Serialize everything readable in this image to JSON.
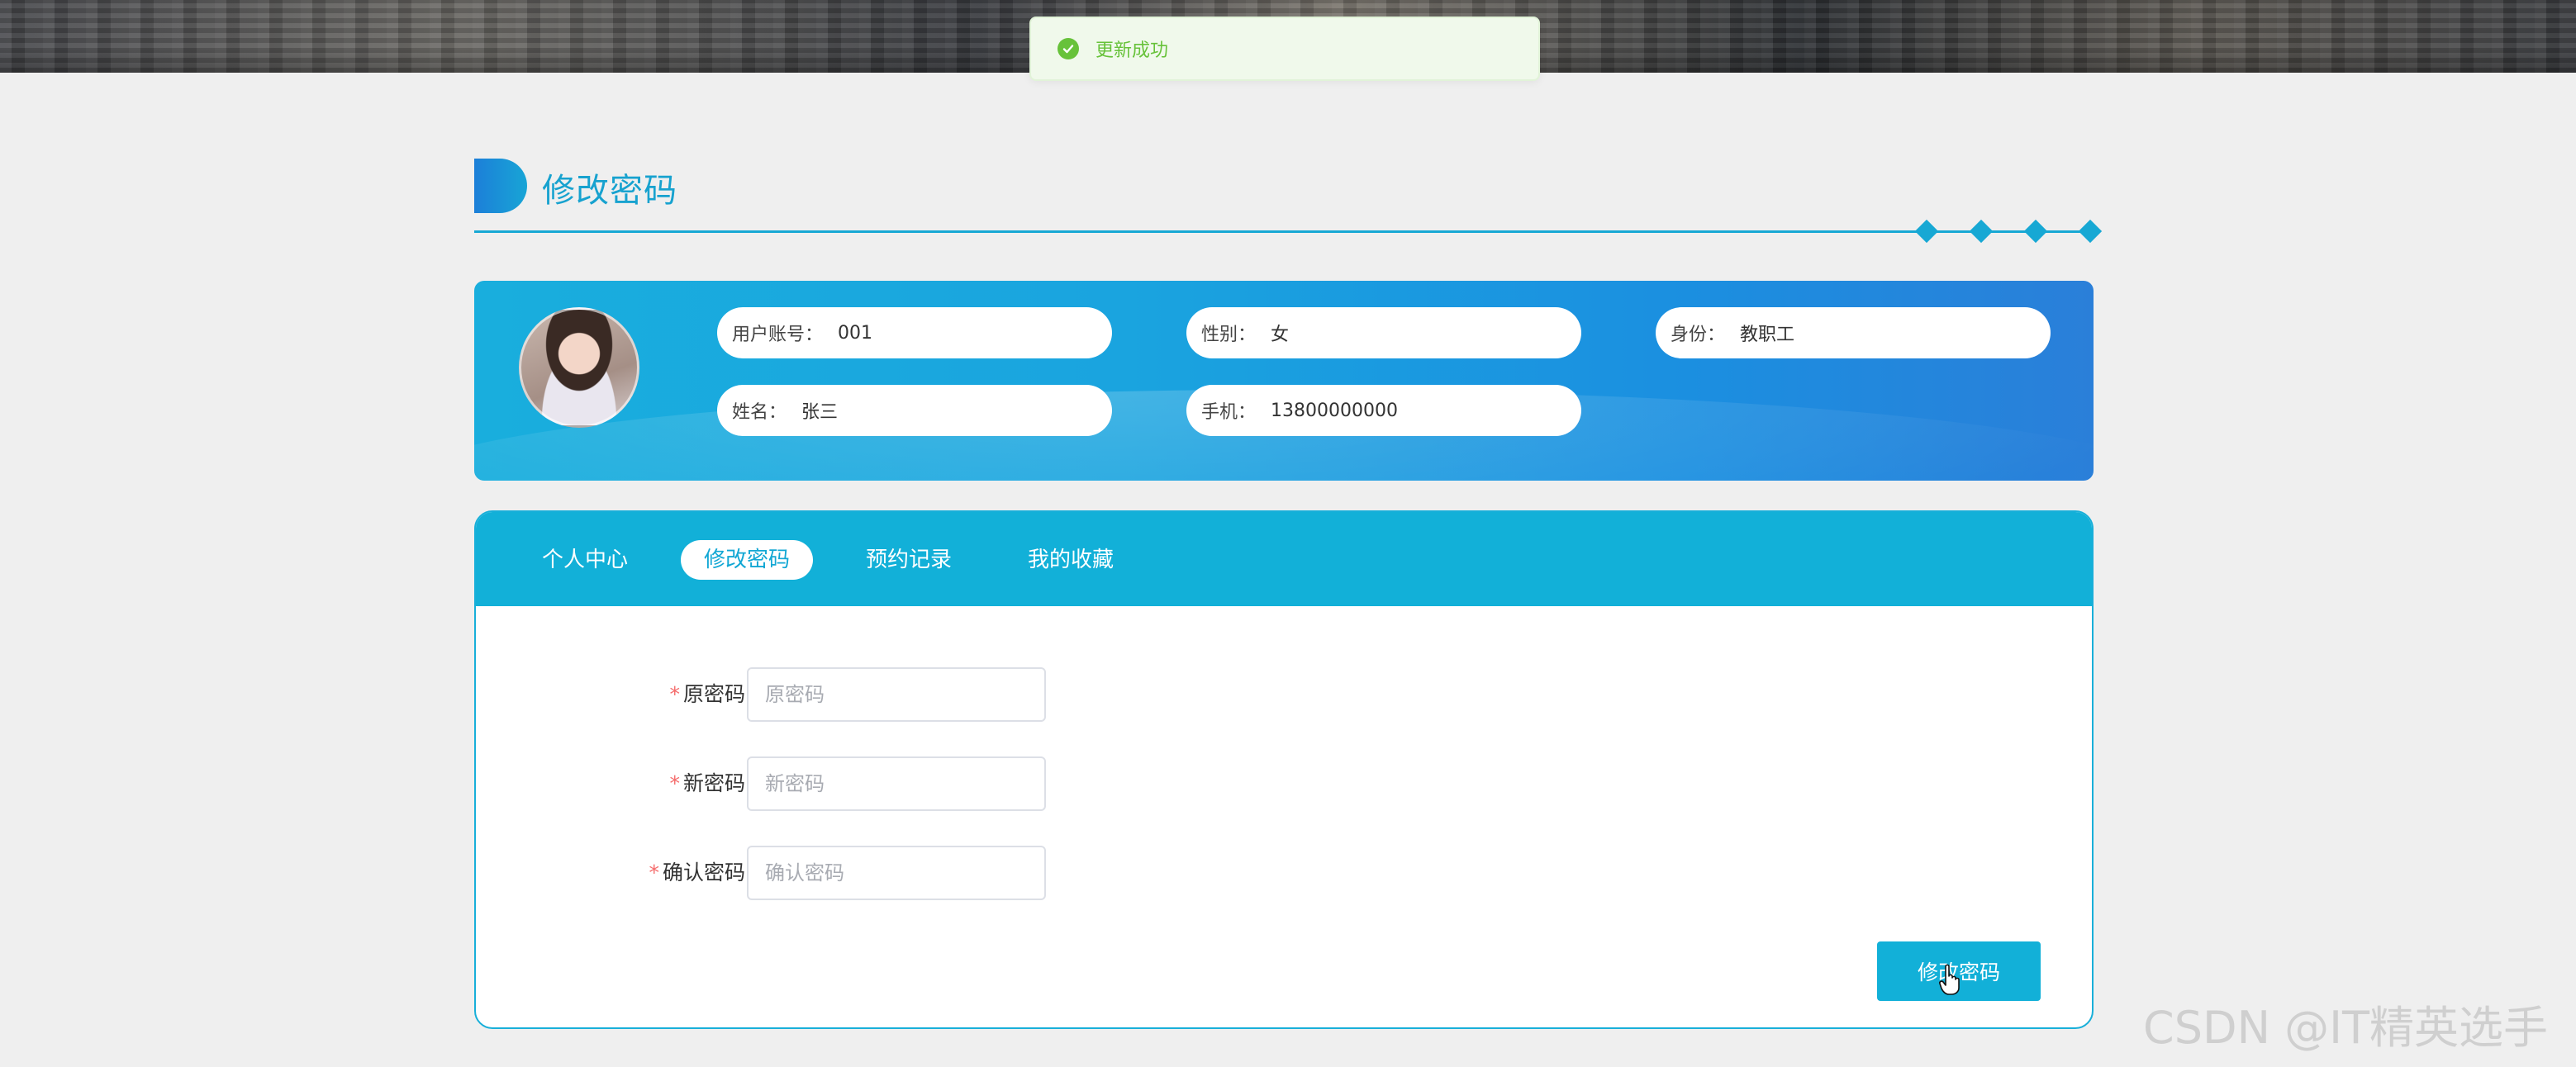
{
  "toast": {
    "message": "更新成功",
    "icon": "check-circle-icon",
    "color": "#67c23a"
  },
  "section": {
    "title": "修改密码"
  },
  "user_info": {
    "account_label": "用户账号：",
    "account_value": "001",
    "gender_label": "性别：",
    "gender_value": "女",
    "role_label": "身份：",
    "role_value": "教职工",
    "name_label": "姓名：",
    "name_value": "张三",
    "phone_label": "手机：",
    "phone_value": "13800000000"
  },
  "tabs": [
    {
      "label": "个人中心",
      "active": false
    },
    {
      "label": "修改密码",
      "active": true
    },
    {
      "label": "预约记录",
      "active": false
    },
    {
      "label": "我的收藏",
      "active": false
    }
  ],
  "form": {
    "required_mark": "*",
    "old_password": {
      "label": "原密码",
      "placeholder": "原密码",
      "value": ""
    },
    "new_password": {
      "label": "新密码",
      "placeholder": "新密码",
      "value": ""
    },
    "confirm_password": {
      "label": "确认密码",
      "placeholder": "确认密码",
      "value": ""
    },
    "submit_label": "修改密码"
  },
  "watermark": "CSDN @IT精英选手",
  "colors": {
    "accent": "#12b0d8",
    "title": "#17a2cf",
    "success": "#67c23a",
    "required": "#f56c6c"
  }
}
